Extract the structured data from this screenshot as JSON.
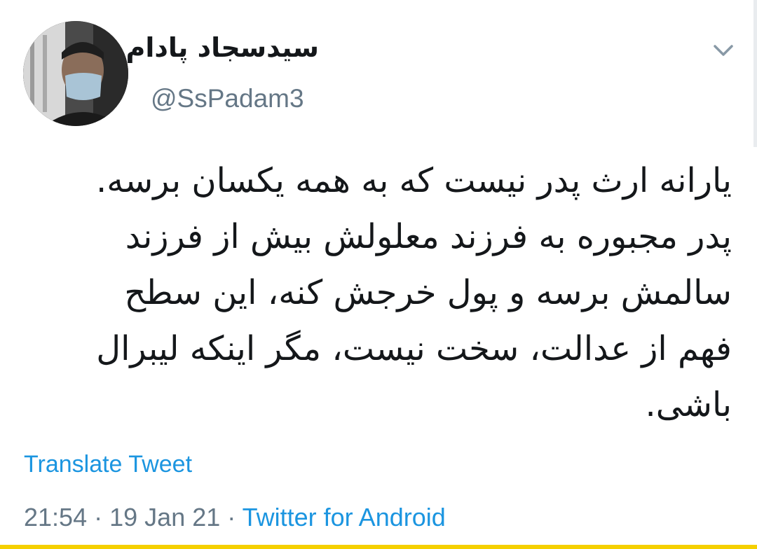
{
  "user": {
    "display_name": "سیدسجاد پادام",
    "handle": "@SsPadam3"
  },
  "tweet": {
    "lines": [
      "یارانه ارث پدر نیست که به همه یکسان برسه.",
      "پدر مجبوره به فرزند معلولش بیش از فرزند",
      "سالمش برسه و پول خرجش کنه، این سطح",
      "فهم از عدالت، سخت نیست، مگر اینکه لیبرال",
      "باشی."
    ]
  },
  "translate_label": "Translate Tweet",
  "meta": {
    "time": "21:54",
    "separator": "·",
    "date": "19 Jan 21",
    "source": "Twitter for Android"
  },
  "icons": {
    "menu": "chevron-down-icon",
    "avatar": "user-avatar"
  },
  "colors": {
    "link": "#1b95e0",
    "secondary": "#657786",
    "text": "#14171a",
    "bottom_bar": "#f5d000"
  }
}
